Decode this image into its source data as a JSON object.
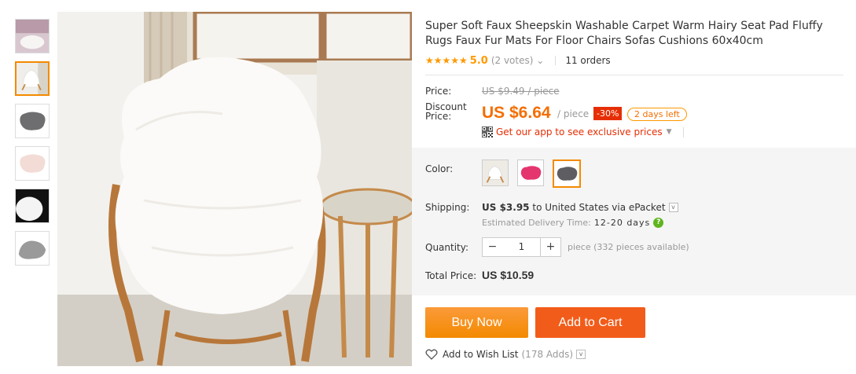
{
  "product": {
    "title": "Super Soft Faux Sheepskin Washable Carpet Warm Hairy Seat Pad Fluffy Rugs Faux Fur Mats For Floor Chairs Sofas Cushions 60x40cm",
    "stars": "★★★★★",
    "rating": "5.0",
    "votes": "(2 votes)",
    "votes_caret": "⌄",
    "orders": "11 orders"
  },
  "price": {
    "label": "Price:",
    "original": "US $9.49 / piece",
    "discount_label_line1": "Discount",
    "discount_label_line2": "Price:",
    "current": "US $6.64",
    "unit": "/ piece",
    "discount_badge": "-30%",
    "days_left": "2 days left",
    "app_promo": "Get our app to see exclusive prices",
    "app_caret": "▼"
  },
  "color": {
    "label": "Color:",
    "swatches": [
      "white-chair",
      "pink-rug",
      "grey-rug"
    ],
    "selected_index": 2
  },
  "shipping": {
    "label": "Shipping:",
    "cost": "US $3.95",
    "to_text": "to United States via ePacket",
    "dropdown_caret": "v",
    "delivery_label": "Estimated Delivery Time:",
    "delivery_days": "12-20 days",
    "help_glyph": "?"
  },
  "quantity": {
    "label": "Quantity:",
    "minus": "−",
    "value": "1",
    "plus": "+",
    "available": "piece (332 pieces available)"
  },
  "total": {
    "label": "Total Price:",
    "value": "US $10.59"
  },
  "actions": {
    "buy_now": "Buy Now",
    "add_to_cart": "Add to Cart",
    "wish_list": "Add to Wish List",
    "wish_adds": "(178 Adds)",
    "wish_caret": "v"
  },
  "thumbnails": [
    "white-rug-room",
    "white-rug-chair",
    "grey-rug",
    "pink-rug",
    "black-white-rug",
    "grey-fur-closeup"
  ],
  "active_thumbnail": 1,
  "colors": {
    "accent_orange": "#f38a00",
    "price_orange": "#f46e02",
    "discount_red": "#e62e04",
    "cart_red": "#f25c1a",
    "help_green": "#5fb41f"
  }
}
